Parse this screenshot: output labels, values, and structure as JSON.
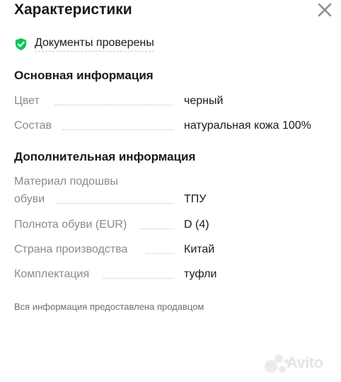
{
  "header": {
    "title": "Характеристики",
    "close_icon": "close-icon"
  },
  "verified": {
    "icon": "shield-check-icon",
    "label": "Документы проверены",
    "accent_color": "#00c853"
  },
  "sections": [
    {
      "title": "Основная информация",
      "rows": [
        {
          "name": "Цвет",
          "value": "черный"
        },
        {
          "name": "Состав",
          "value": "натуральная кожа 100%"
        }
      ]
    },
    {
      "title": "Дополнительная информация",
      "rows": [
        {
          "name": "Материал подошвы обуви",
          "value": "ТПУ"
        },
        {
          "name": "Полнота обуви (EUR)",
          "value": "D (4)"
        },
        {
          "name": "Страна производства",
          "value": "Китай"
        },
        {
          "name": "Комплектация",
          "value": "туфли"
        }
      ]
    }
  ],
  "footer": {
    "note": "Вся информация предоставлена продавцом"
  },
  "watermark": {
    "text": "Avito"
  }
}
